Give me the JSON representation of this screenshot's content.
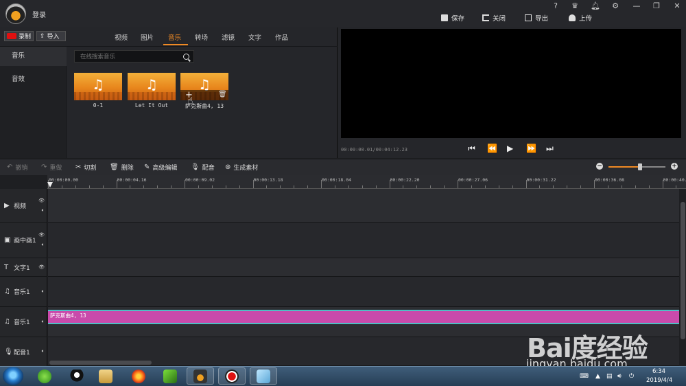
{
  "header": {
    "login_label": "登录",
    "window_controls": [
      "?",
      "vip-icon",
      "bell-icon",
      "gear-icon",
      "minimize-icon",
      "restore-icon",
      "close-icon"
    ],
    "actions": [
      {
        "label": "保存",
        "icon": "save-icon"
      },
      {
        "label": "关闭",
        "icon": "exit-icon"
      },
      {
        "label": "导出",
        "icon": "export-icon"
      },
      {
        "label": "上传",
        "icon": "cloud-upload-icon"
      }
    ]
  },
  "library": {
    "record_label": "录制",
    "import_label": "导入",
    "tabs": [
      {
        "label": "视频",
        "active": false
      },
      {
        "label": "图片",
        "active": false
      },
      {
        "label": "音乐",
        "active": true
      },
      {
        "label": "转场",
        "active": false
      },
      {
        "label": "滤镜",
        "active": false
      },
      {
        "label": "文字",
        "active": false
      },
      {
        "label": "作品",
        "active": false
      }
    ],
    "sidebar": [
      {
        "label": "音乐",
        "active": true
      },
      {
        "label": "音效",
        "active": false
      }
    ],
    "search_placeholder": "在线搜索音乐",
    "items": [
      {
        "label": "0-1"
      },
      {
        "label": "Let It Out"
      },
      {
        "label": "萨克斯曲4, 13"
      }
    ]
  },
  "preview": {
    "timecode": "00:00:00.01/00:04:12.23",
    "controls": [
      "skip-back-icon",
      "step-back-icon",
      "play-icon",
      "step-forward-icon",
      "skip-forward-icon"
    ]
  },
  "toolbar": {
    "undo": "撤销",
    "redo": "重做",
    "cut": "切割",
    "delete": "删除",
    "advanced_edit": "高级编辑",
    "dub": "配音",
    "generate": "生成素材",
    "zoom_level": 0.55
  },
  "timeline": {
    "ruler": [
      "00:00:00.00",
      "00:00:04.16",
      "00:00:09.02",
      "00:00:13.18",
      "00:00:18.04",
      "00:00:22.20",
      "00:00:27.06",
      "00:00:31.22",
      "00:00:36.08",
      "00:00:40."
    ],
    "tracks": [
      {
        "label": "视频"
      },
      {
        "label": "画中画1"
      },
      {
        "label": "文字1"
      },
      {
        "label": "音乐1"
      },
      {
        "label": "音乐1"
      },
      {
        "label": "配音1"
      }
    ],
    "clip_label": "萨克斯曲4, 13"
  },
  "watermark": {
    "logo": "Bai度经验",
    "url": "jingyan.baidu.com"
  },
  "taskbar": {
    "time": "6:34",
    "date": "2019/4/4",
    "colors": {
      "accent": "#f08a24",
      "clip": "#c94aab",
      "clip_border": "#4fbfc4"
    }
  }
}
